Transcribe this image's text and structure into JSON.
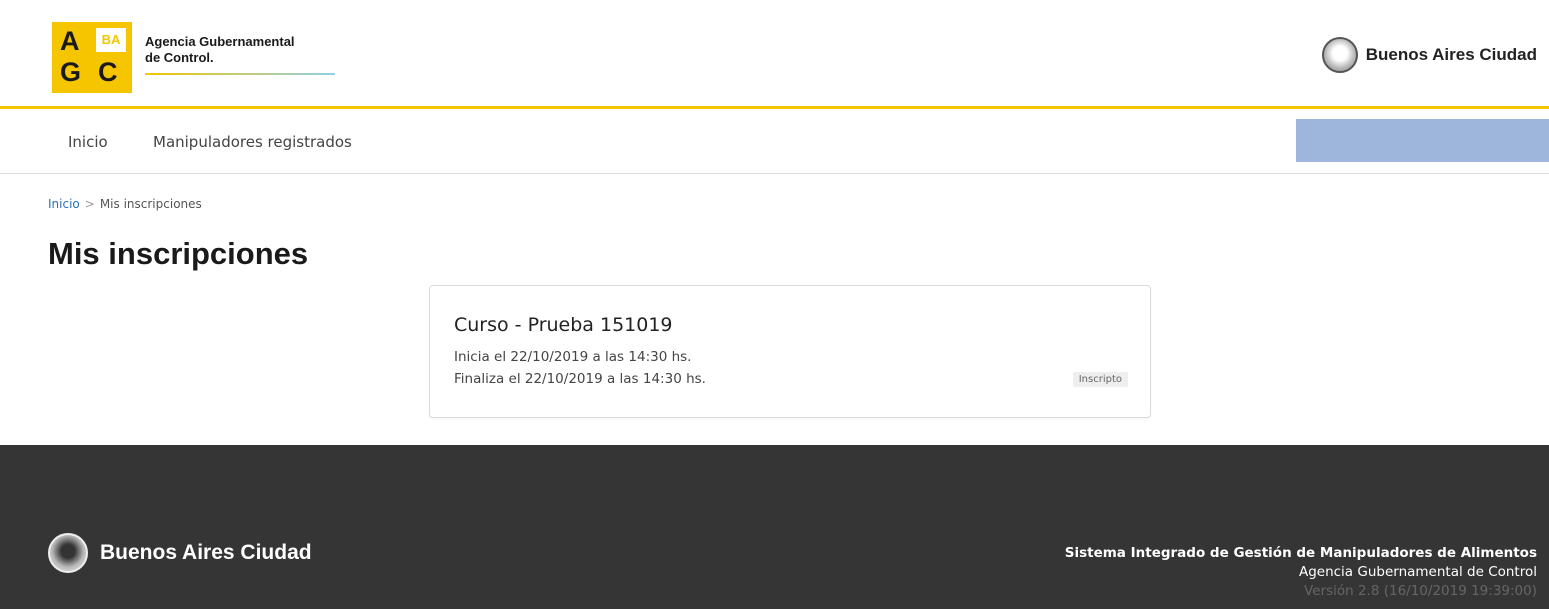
{
  "header": {
    "agc_logo": {
      "letters": [
        "A",
        "G",
        "C"
      ],
      "badge": "BA"
    },
    "agency_name_line1": "Agencia Gubernamental",
    "agency_name_line2": "de Control.",
    "city_brand": "Buenos Aires Ciudad",
    "accent_color": "#f5c500"
  },
  "nav": {
    "items": [
      {
        "label": "Inicio"
      },
      {
        "label": "Manipuladores registrados"
      }
    ],
    "user_box_color": "#9fb6dc"
  },
  "breadcrumb": {
    "home": "Inicio",
    "separator": ">",
    "current": "Mis inscripciones"
  },
  "page": {
    "title": "Mis inscripciones"
  },
  "courses": [
    {
      "title": "Curso - Prueba 151019",
      "start": "Inicia el 22/10/2019 a las 14:30 hs.",
      "end": "Finaliza el 22/10/2019 a las 14:30 hs.",
      "status": "Inscripto"
    }
  ],
  "footer": {
    "city_brand": "Buenos Aires Ciudad",
    "system_name": "Sistema Integrado de Gestión de Manipuladores de Alimentos",
    "organization": "Agencia Gubernamental de Control",
    "version": "Versión 2.8 (16/10/2019 19:39:00)",
    "background": "#353535"
  }
}
